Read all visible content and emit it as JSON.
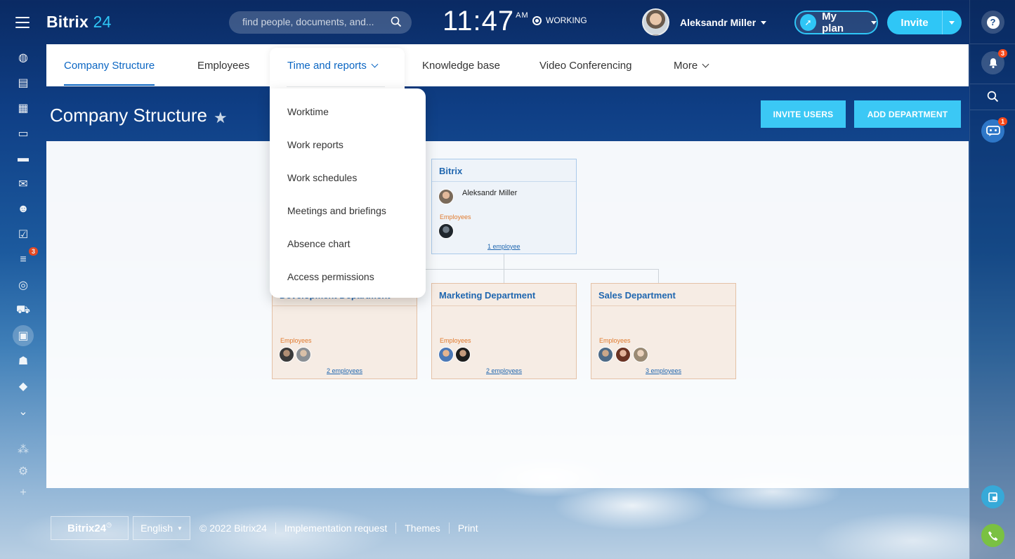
{
  "app": {
    "logo_text": "Bitrix",
    "logo_num": "24",
    "search_placeholder": "find people, documents, and...",
    "clock_time": "11:47",
    "clock_ampm": "AM",
    "working_status": "WORKING",
    "user_name": "Aleksandr Miller",
    "myplan_label": "My plan",
    "invite_label": "Invite"
  },
  "left_sidebar": {
    "icons": [
      {
        "name": "feed-icon",
        "glyph": "◍"
      },
      {
        "name": "tasks-icon",
        "glyph": "▤"
      },
      {
        "name": "calendar-icon",
        "glyph": "▦"
      },
      {
        "name": "docs-icon",
        "glyph": "▭"
      },
      {
        "name": "drive-icon",
        "glyph": "▬"
      },
      {
        "name": "mail-icon",
        "glyph": "✉"
      },
      {
        "name": "employees-icon",
        "glyph": "☻"
      },
      {
        "name": "checklist-icon",
        "glyph": "☑"
      },
      {
        "name": "crm-icon",
        "glyph": "≡",
        "badge": "3"
      },
      {
        "name": "marketing-icon",
        "glyph": "◎"
      },
      {
        "name": "shop-icon",
        "glyph": "⛟"
      },
      {
        "name": "company-icon",
        "glyph": "▣",
        "active": true
      },
      {
        "name": "robot-icon",
        "glyph": "☗"
      },
      {
        "name": "box-icon",
        "glyph": "◆"
      },
      {
        "name": "more-icon",
        "glyph": "⌄"
      }
    ],
    "bottom_icons": [
      {
        "name": "sitemap-icon",
        "glyph": "⁂"
      },
      {
        "name": "gear-icon",
        "glyph": "⚙"
      },
      {
        "name": "plus-icon",
        "glyph": "+"
      }
    ]
  },
  "right_sidebar": {
    "help": "?",
    "notifications_badge": "3",
    "chat_badge": "1"
  },
  "topnav": {
    "tabs": [
      {
        "label": "Company Structure"
      },
      {
        "label": "Employees"
      },
      {
        "label": "Time and reports"
      },
      {
        "label": "Knowledge base"
      },
      {
        "label": "Video Conferencing"
      },
      {
        "label": "More"
      }
    ]
  },
  "dropdown": {
    "items": [
      "Worktime",
      "Work reports",
      "Work schedules",
      "Meetings and briefings",
      "Absence chart",
      "Access permissions"
    ]
  },
  "page": {
    "title": "Company Structure",
    "invite_users": "INVITE USERS",
    "add_department": "ADD DEPARTMENT"
  },
  "structure": {
    "root": {
      "name": "Bitrix",
      "head": "Aleksandr Miller",
      "employees_label": "Employees",
      "count": "1 employee"
    },
    "departments": [
      {
        "name": "Development Department",
        "employees_label": "Employees",
        "count": "2 employees"
      },
      {
        "name": "Marketing Department",
        "employees_label": "Employees",
        "count": "2 employees"
      },
      {
        "name": "Sales Department",
        "employees_label": "Employees",
        "count": "3 employees"
      }
    ]
  },
  "footer": {
    "logo": "Bitrix24",
    "language": "English",
    "copyright": "© 2022 Bitrix24",
    "impl_request": "Implementation request",
    "themes": "Themes",
    "print": "Print"
  }
}
